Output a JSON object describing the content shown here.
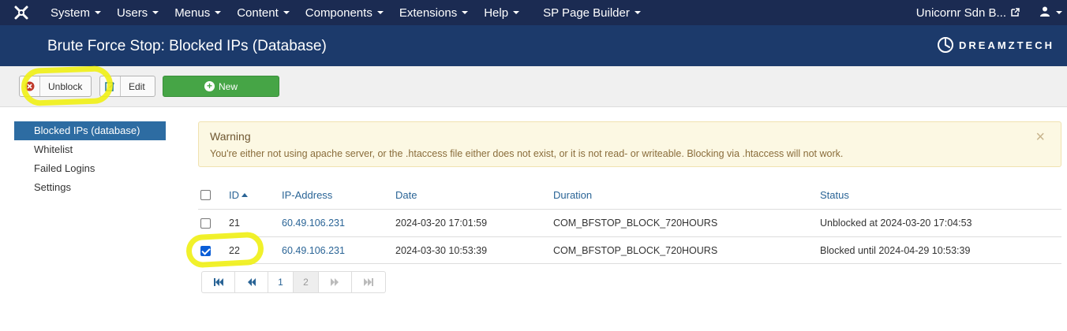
{
  "navbar": {
    "menu": [
      {
        "label": "System"
      },
      {
        "label": "Users"
      },
      {
        "label": "Menus"
      },
      {
        "label": "Content"
      },
      {
        "label": "Components"
      },
      {
        "label": "Extensions"
      },
      {
        "label": "Help"
      },
      {
        "label": "SP Page Builder"
      }
    ],
    "site_name": "Unicornr Sdn B...",
    "icons": {
      "logo": "joomla-icon",
      "external": "external-link-icon",
      "user": "user-icon"
    }
  },
  "header": {
    "title": "Brute Force Stop: Blocked IPs (Database)",
    "brand": "DREAMZTECH",
    "colors": {
      "navbar": "#1b2b52",
      "header": "#1c3a6b"
    }
  },
  "toolbar": {
    "unblock_label": "Unblock",
    "edit_label": "Edit",
    "new_label": "New",
    "new_color": "#46a546"
  },
  "sidebar": {
    "items": [
      {
        "label": "Blocked IPs (database)",
        "active": true
      },
      {
        "label": "Whitelist"
      },
      {
        "label": "Failed Logins"
      },
      {
        "label": "Settings"
      }
    ],
    "active_color": "#2d6ca2"
  },
  "alert": {
    "title": "Warning",
    "message": "You're either not using apache server, or the .htaccess file either does not exist, or it is not read- or writeable. Blocking via .htaccess will not work.",
    "close": "×"
  },
  "table": {
    "headers": {
      "id": "ID",
      "ip": "IP-Address",
      "date": "Date",
      "duration": "Duration",
      "status": "Status"
    },
    "rows": [
      {
        "id": "21",
        "ip": "60.49.106.231",
        "date": "2024-03-20 17:01:59",
        "duration": "COM_BFSTOP_BLOCK_720HOURS",
        "status": "Unblocked at 2024-03-20 17:04:53",
        "checked": false
      },
      {
        "id": "22",
        "ip": "60.49.106.231",
        "date": "2024-03-30 10:53:39",
        "duration": "COM_BFSTOP_BLOCK_720HOURS",
        "status": "Blocked until 2024-04-29 10:53:39",
        "checked": true
      }
    ]
  },
  "pagination": {
    "pages": [
      "1",
      "2"
    ],
    "current": "2"
  }
}
